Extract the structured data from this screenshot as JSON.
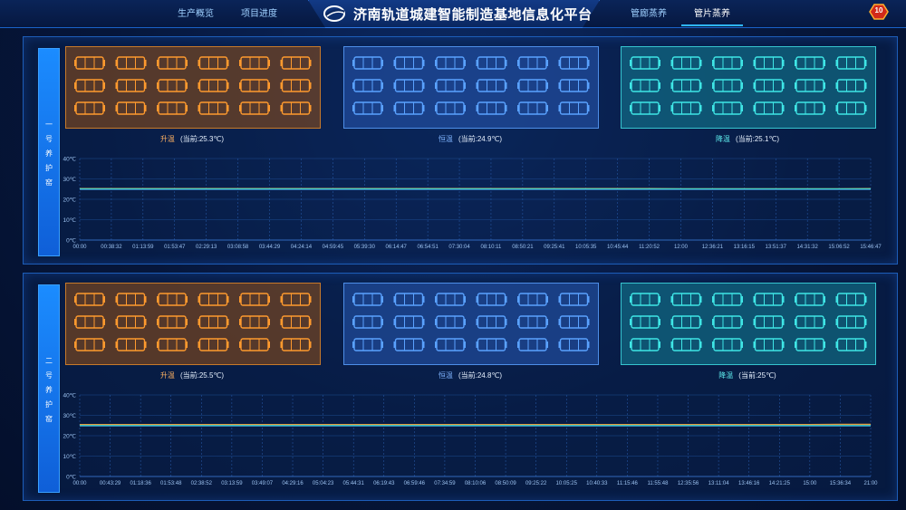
{
  "nav": {
    "left": [
      "生产概览",
      "项目进度"
    ],
    "right": [
      "管廊蒸养",
      "管片蒸养"
    ],
    "active_index": 1
  },
  "header": {
    "title": "济南轨道城建智能制造基地信息化平台"
  },
  "alarm_badge": {
    "count": "10"
  },
  "panels": [
    {
      "name": "一号养护窑",
      "name_chars": [
        "一",
        "号",
        "养",
        "护",
        "窑"
      ],
      "zones": [
        {
          "label": "升温",
          "current": "(当前:25.3℃)",
          "color": "orange",
          "cars": 18
        },
        {
          "label": "恒温",
          "current": "(当前:24.9℃)",
          "color": "blue",
          "cars": 18
        },
        {
          "label": "降温",
          "current": "(当前:25.1℃)",
          "color": "cyan",
          "cars": 18
        }
      ],
      "chart_data": {
        "type": "line",
        "y_ticks": [
          "0℃",
          "10℃",
          "20℃",
          "30℃",
          "40℃"
        ],
        "ylim": [
          0,
          40
        ],
        "x_labels": [
          "00:00",
          "00:38:32",
          "01:13:59",
          "01:53:47",
          "02:29:13",
          "03:08:58",
          "03:44:29",
          "04:24:14",
          "04:59:45",
          "05:39:30",
          "06:14:47",
          "06:54:51",
          "07:30:04",
          "08:10:11",
          "08:50:21",
          "09:25:41",
          "10:05:35",
          "10:45:44",
          "11:20:52",
          "12:00",
          "12:36:21",
          "13:16:15",
          "13:51:37",
          "14:31:32",
          "15:06:52",
          "15:46:47"
        ],
        "series": [
          {
            "values": [
              25.3,
              25.3,
              25.3,
              25.3,
              25.3,
              25.3,
              25.3,
              25.3,
              25.3,
              25.3,
              25.3,
              25.3,
              25.3,
              25.3,
              25.3,
              25.3,
              25.3,
              25.3,
              25.3,
              25.2,
              25.2,
              25.2,
              25.2,
              25.2,
              25.2,
              25.3
            ],
            "color": "#e39a3c"
          },
          {
            "values": [
              24.9,
              24.9,
              24.9,
              24.9,
              24.9,
              24.9,
              24.9,
              24.9,
              24.9,
              24.9,
              24.9,
              24.9,
              24.9,
              24.9,
              24.9,
              24.9,
              24.9,
              24.9,
              24.9,
              24.9,
              24.9,
              24.9,
              24.9,
              24.9,
              24.9,
              24.9
            ],
            "color": "#4d8ee8"
          },
          {
            "values": [
              25.1,
              25.1,
              25.1,
              25.1,
              25.1,
              25.1,
              25.1,
              25.1,
              25.1,
              25.1,
              25.1,
              25.1,
              25.1,
              25.1,
              25.1,
              25.1,
              25.1,
              25.1,
              25.1,
              25.1,
              25.1,
              25.1,
              25.1,
              25.1,
              25.1,
              25.1
            ],
            "color": "#3fd6cf"
          }
        ]
      }
    },
    {
      "name": "二号养护窑",
      "name_chars": [
        "二",
        "号",
        "养",
        "护",
        "窑"
      ],
      "zones": [
        {
          "label": "升温",
          "current": "(当前:25.5℃)",
          "color": "orange",
          "cars": 18
        },
        {
          "label": "恒温",
          "current": "(当前:24.8℃)",
          "color": "blue",
          "cars": 18
        },
        {
          "label": "降温",
          "current": "(当前:25℃)",
          "color": "cyan",
          "cars": 18
        }
      ],
      "chart_data": {
        "type": "line",
        "y_ticks": [
          "0℃",
          "10℃",
          "20℃",
          "30℃",
          "40℃"
        ],
        "ylim": [
          0,
          40
        ],
        "x_labels": [
          "00:00",
          "00:43:29",
          "01:18:36",
          "01:53:48",
          "02:38:52",
          "03:13:59",
          "03:49:07",
          "04:29:16",
          "05:04:23",
          "05:44:31",
          "06:19:43",
          "06:59:46",
          "07:34:59",
          "08:10:06",
          "08:50:09",
          "09:25:22",
          "10:05:25",
          "10:40:33",
          "11:15:46",
          "11:55:48",
          "12:35:56",
          "13:11:04",
          "13:46:16",
          "14:21:25",
          "15:00",
          "15:36:34",
          "21:00"
        ],
        "series": [
          {
            "values": [
              25.5,
              25.5,
              25.5,
              25.5,
              25.5,
              25.5,
              25.5,
              25.5,
              25.5,
              25.5,
              25.5,
              25.5,
              25.5,
              25.5,
              25.5,
              25.5,
              25.5,
              25.5,
              25.5,
              25.5,
              25.5,
              25.5,
              25.5,
              25.5,
              25.5,
              25.6,
              25.6
            ],
            "color": "#e39a3c"
          },
          {
            "values": [
              24.8,
              24.8,
              24.8,
              24.8,
              24.8,
              24.8,
              24.8,
              24.8,
              24.8,
              24.8,
              24.8,
              24.8,
              24.8,
              24.8,
              24.8,
              24.8,
              24.8,
              24.8,
              24.8,
              24.8,
              24.8,
              24.8,
              24.8,
              24.8,
              24.8,
              24.8,
              24.8
            ],
            "color": "#4d8ee8"
          },
          {
            "values": [
              25.0,
              25.0,
              25.0,
              25.0,
              25.0,
              25.0,
              25.0,
              25.0,
              25.0,
              25.0,
              25.0,
              25.0,
              25.0,
              25.0,
              25.0,
              25.0,
              25.0,
              25.0,
              25.0,
              25.0,
              25.0,
              25.0,
              25.0,
              25.0,
              25.0,
              25.0,
              25.0
            ],
            "color": "#3fd6cf"
          }
        ]
      }
    }
  ]
}
